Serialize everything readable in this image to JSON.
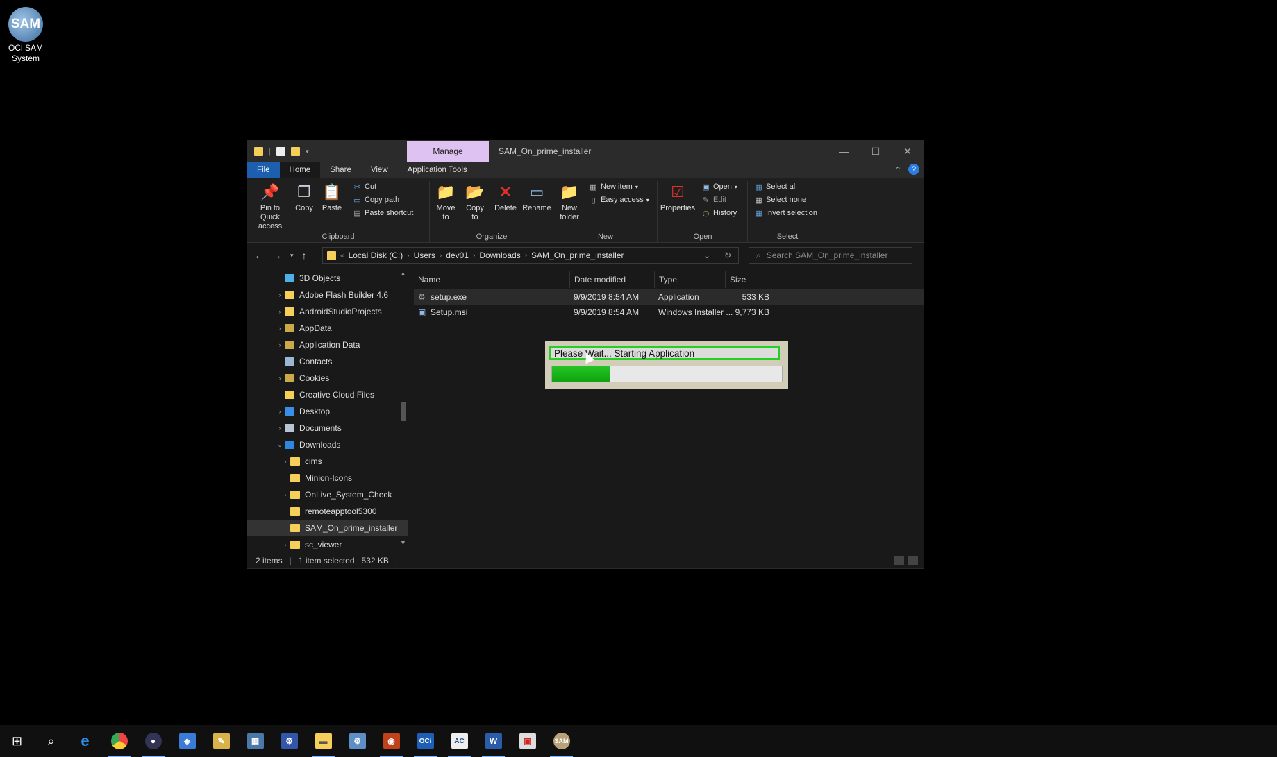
{
  "desktop": {
    "icon_label": "OCi SAM System",
    "icon_text": "SAM"
  },
  "window": {
    "manage_tab": "Manage",
    "title": "SAM_On_prime_installer",
    "tabs": [
      "File",
      "Home",
      "Share",
      "View",
      "Application Tools"
    ]
  },
  "ribbon": {
    "clipboard": {
      "group_label": "Clipboard",
      "pin": "Pin to Quick access",
      "copy": "Copy",
      "paste": "Paste",
      "cut": "Cut",
      "copy_path": "Copy path",
      "paste_shortcut": "Paste shortcut"
    },
    "organize": {
      "group_label": "Organize",
      "move_to": "Move to",
      "copy_to": "Copy to",
      "delete": "Delete",
      "rename": "Rename"
    },
    "new": {
      "group_label": "New",
      "new_folder": "New folder",
      "new_item": "New item",
      "easy_access": "Easy access"
    },
    "open": {
      "group_label": "Open",
      "properties": "Properties",
      "open": "Open",
      "edit": "Edit",
      "history": "History"
    },
    "select": {
      "group_label": "Select",
      "select_all": "Select all",
      "select_none": "Select none",
      "invert": "Invert selection"
    }
  },
  "address": {
    "crumbs": [
      "Local Disk (C:)",
      "Users",
      "dev01",
      "Downloads",
      "SAM_On_prime_installer"
    ],
    "search_placeholder": "Search SAM_On_prime_installer"
  },
  "navpane": {
    "items": [
      {
        "label": "3D Objects",
        "color": "#4fb0e8"
      },
      {
        "label": "Adobe Flash Builder 4.6",
        "color": "#f6cf5a"
      },
      {
        "label": "AndroidStudioProjects",
        "color": "#f6cf5a"
      },
      {
        "label": "AppData",
        "color": "#c9a94a"
      },
      {
        "label": "Application Data",
        "color": "#c9a94a"
      },
      {
        "label": "Contacts",
        "color": "#9bb7d4"
      },
      {
        "label": "Cookies",
        "color": "#c9a94a"
      },
      {
        "label": "Creative Cloud Files",
        "color": "#f6cf5a"
      },
      {
        "label": "Desktop",
        "color": "#3a8ee6"
      },
      {
        "label": "Documents",
        "color": "#b8c4d0"
      },
      {
        "label": "Downloads",
        "color": "#2f86e0"
      },
      {
        "label": "cims",
        "color": "#f6cf5a"
      },
      {
        "label": "Minion-Icons",
        "color": "#f6cf5a"
      },
      {
        "label": "OnLive_System_Check",
        "color": "#f6cf5a"
      },
      {
        "label": "remoteapptool5300",
        "color": "#f6cf5a"
      },
      {
        "label": "SAM_On_prime_installer",
        "color": "#f6cf5a"
      },
      {
        "label": "sc_viewer",
        "color": "#f6cf5a"
      }
    ]
  },
  "filelist": {
    "columns": [
      "Name",
      "Date modified",
      "Type",
      "Size"
    ],
    "rows": [
      {
        "name": "setup.exe",
        "date": "9/9/2019 8:54 AM",
        "type": "Application",
        "size": "533 KB"
      },
      {
        "name": "Setup.msi",
        "date": "9/9/2019 8:54 AM",
        "type": "Windows Installer ...",
        "size": "9,773 KB"
      }
    ]
  },
  "status": {
    "items": "2 items",
    "selected": "1 item selected",
    "size": "532 KB"
  },
  "dialog": {
    "message": "Please Wait... Starting Application",
    "progress": 0.25
  },
  "taskbar": {
    "icons": [
      "windows-start-icon",
      "search-icon",
      "edge-icon",
      "chrome-icon",
      "vpn-icon",
      "network-icon",
      "tools-icon",
      "remote-desktop-icon",
      "remote-app-icon",
      "file-explorer-icon",
      "settings-icon",
      "app-icon",
      "oci-icon",
      "acrobat-icon",
      "word-icon",
      "remote-tool-icon",
      "sam-icon"
    ]
  }
}
